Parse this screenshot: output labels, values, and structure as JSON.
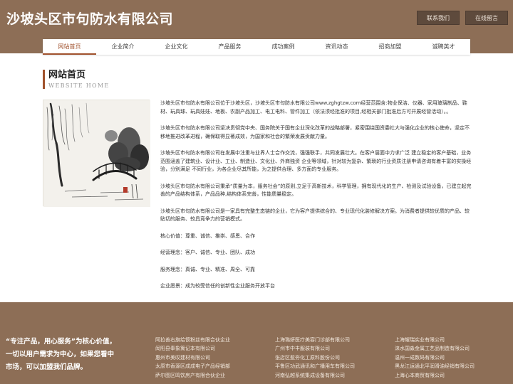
{
  "header": {
    "title": "沙坡头区市句防水有限公司",
    "buttons": {
      "contact": "联系我们",
      "message": "在线留言"
    }
  },
  "nav": {
    "items": [
      "网站首页",
      "企业简介",
      "企业文化",
      "产品服务",
      "成功案例",
      "资讯动态",
      "招商加盟",
      "诚聘英才"
    ],
    "active_index": 0
  },
  "section": {
    "title": "网站首页",
    "subtitle": "WEBSITE HOME"
  },
  "image": {
    "icon": "ink-painting-bridge-willow"
  },
  "content": {
    "paragraphs": [
      "沙坡头区市句防水有限公司位于沙坡头区，沙坡头区市句防水有限公司www.zghgtzw.com经营范围含:物业保洁、仪器、家用玻璃制品、鞋材、玩具球、玩具娃娃、地板、农副产品加工、电工电料、管件加工（依法须经批准的项目,经相关部门批准后方可开展经营活动）。。",
      "沙坡头区市句防水有限公司坚决贯彻党中央、国务院关于国有企业深化改革的战略部署，紧密围绕国资委社大与强化企业的核心使命，坚定不移地推进改革进程，确保取得显著成效，为国家和社会的繁荣发展贡献力量。",
      "沙坡头区市句防水有限公司在发展中注重与业界人士合作交流，强强联手，共同发展壮大。在客户层面中力求广泛 建立稳定的客户基础，业务范围涵盖了建筑业、设计业、工业、制造业、文化业、外商独资 企业等领域，针对较为复杂、繁琐的行业资质注册申请咨询有着丰富的实操经验，分别满足 不同行业，为各企业尽其所能，为之提供合理、多方面的专业服务。",
      "沙坡头区市句防水有限公司秉承“质量为本，服务社会”的原则,立足于高新技术，科学管理，拥有现代化的生产、检测及试验设备，已建立起完善的产品结构体系，产品品种,结构体系完善，性能质量稳定。",
      "沙坡头区市句防水有限公司是一家具有完整生态链的企业，它为客户提供综合的、专业现代化装修解决方案。为消费者提供较优质的产品、较贴切的服务、较具竞争力的营销模式。",
      "核心价值：尊重、诚信、推崇、感恩、合作",
      "经营理念：客户、诚信、专业、团队、成功",
      "服务理念：真诚、专业、精准、周全、可靠",
      "企业愿景：成为较受信任的创新性企业服务开放平台"
    ]
  },
  "footer": {
    "slogan": "“专注产品，用心服务”为核心价值，一切以用户需求为中心，如果您看中市场，可以加盟我们品牌。",
    "links_col1": [
      "阿拉善右旗给惯粉丝有限合伙企业",
      "闵阳县奉象篱记本有限公司",
      "惠州市美叹建材有限公司",
      "太原市香源区成成电子产品经销部",
      "萨尔图区鸣饮房产有限合伙企业"
    ],
    "links_col2": [
      "上海璐妍医疗美容门诊部有限公司",
      "广州市中丰服装有限公司",
      "张店区惹夯化工原料股份公司",
      "平鲁区功武通讯和广播用车有限公司",
      "河南弘越系统集成设备有限公司"
    ],
    "links_col3": [
      "上海耀瑞实业有限公司",
      "涞水国淼金属工艺品制造有限公司",
      "温州一成数码有限公司",
      "黑龙江运通北平润滑油经销有限公司",
      "上海心本商贸有限公司"
    ]
  }
}
